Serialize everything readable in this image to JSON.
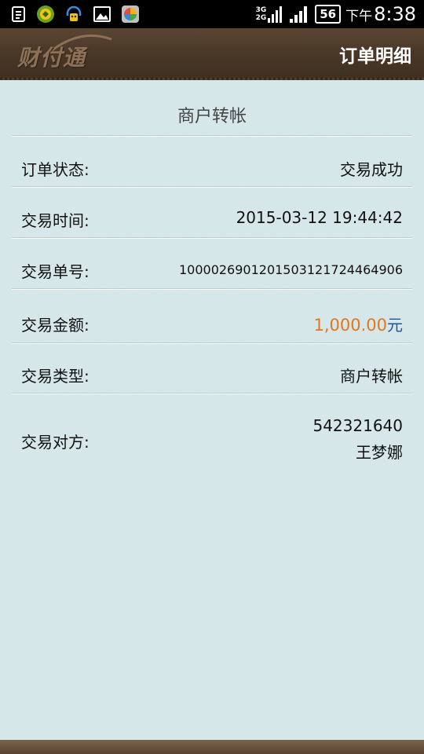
{
  "status_bar": {
    "network_types": [
      "3G",
      "2G"
    ],
    "battery_level": "56",
    "time_prefix": "下午",
    "time": "8:38",
    "icons": [
      "notes-icon",
      "kiwi-app-icon",
      "headset-bot-icon",
      "gallery-icon",
      "market-app-icon"
    ]
  },
  "header": {
    "logo_text": "财付通",
    "title": "订单明细"
  },
  "order": {
    "section_title": "商户转帐",
    "rows": [
      {
        "label": "订单状态:",
        "value": "交易成功"
      },
      {
        "label": "交易时间:",
        "value": "2015-03-12 19:44:42"
      },
      {
        "label": "交易单号:",
        "value": "1000026901201503121724464906"
      },
      {
        "label": "交易金额:",
        "amount": "1,000.00",
        "unit": "元"
      },
      {
        "label": "交易类型:",
        "value": "商户转帐"
      },
      {
        "label": "交易对方:",
        "account": "542321640",
        "name": "王梦娜"
      }
    ]
  },
  "colors": {
    "background": "#d6e7e9",
    "header": "#4a3827",
    "amount": "#e2771e",
    "unit": "#1b56a8"
  }
}
